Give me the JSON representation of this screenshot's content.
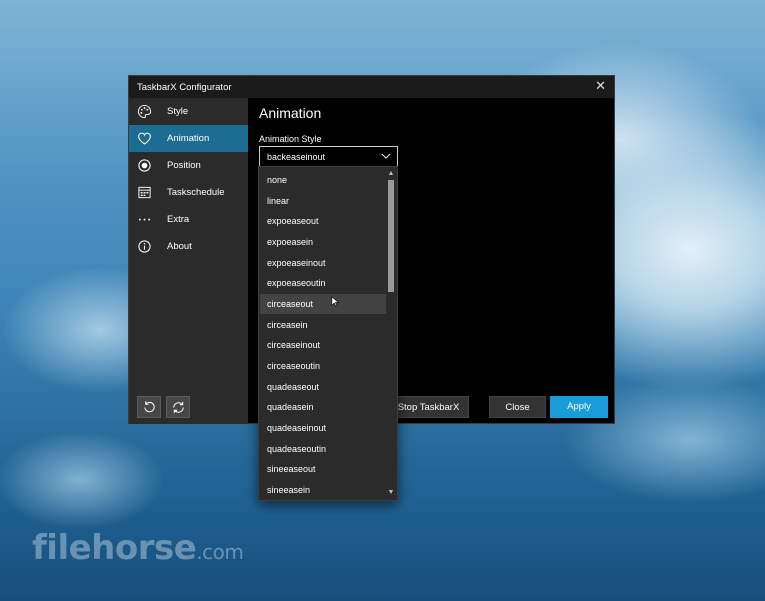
{
  "watermark": {
    "brand": "filehorse",
    "domain": ".com"
  },
  "window": {
    "title": "TaskbarX Configurator",
    "close_glyph": "✕"
  },
  "sidebar": {
    "items": [
      {
        "label": "Style",
        "icon": "palette-icon",
        "active": false
      },
      {
        "label": "Animation",
        "icon": "heart-icon",
        "active": true
      },
      {
        "label": "Position",
        "icon": "radio-target-icon",
        "active": false
      },
      {
        "label": "Taskschedule",
        "icon": "calendar-icon",
        "active": false
      },
      {
        "label": "Extra",
        "icon": "more-dots-icon",
        "active": false
      },
      {
        "label": "About",
        "icon": "info-icon",
        "active": false
      }
    ],
    "bottom_buttons": [
      {
        "icon": "restore-icon"
      },
      {
        "icon": "refresh-icon"
      }
    ]
  },
  "content": {
    "title": "Animation",
    "animation_style": {
      "label": "Animation Style",
      "selected": "backeaseinout",
      "options": [
        "none",
        "linear",
        "expoeaseout",
        "expoeasein",
        "expoeaseinout",
        "expoeaseoutin",
        "circeaseout",
        "circeasein",
        "circeaseinout",
        "circeaseoutin",
        "quadeaseout",
        "quadeasein",
        "quadeaseinout",
        "quadeaseoutin",
        "sineeaseout",
        "sineeasein"
      ],
      "hovered": "circeaseout",
      "scroll_position": 0.0
    }
  },
  "footer": {
    "stop_label": "Stop TaskbarX",
    "close_label": "Close",
    "apply_label": "Apply"
  },
  "colors": {
    "accent": "#199cd8",
    "active_nav": "#1d6d92",
    "sidebar_bg": "#2b2b2b",
    "window_bg": "#000000"
  }
}
